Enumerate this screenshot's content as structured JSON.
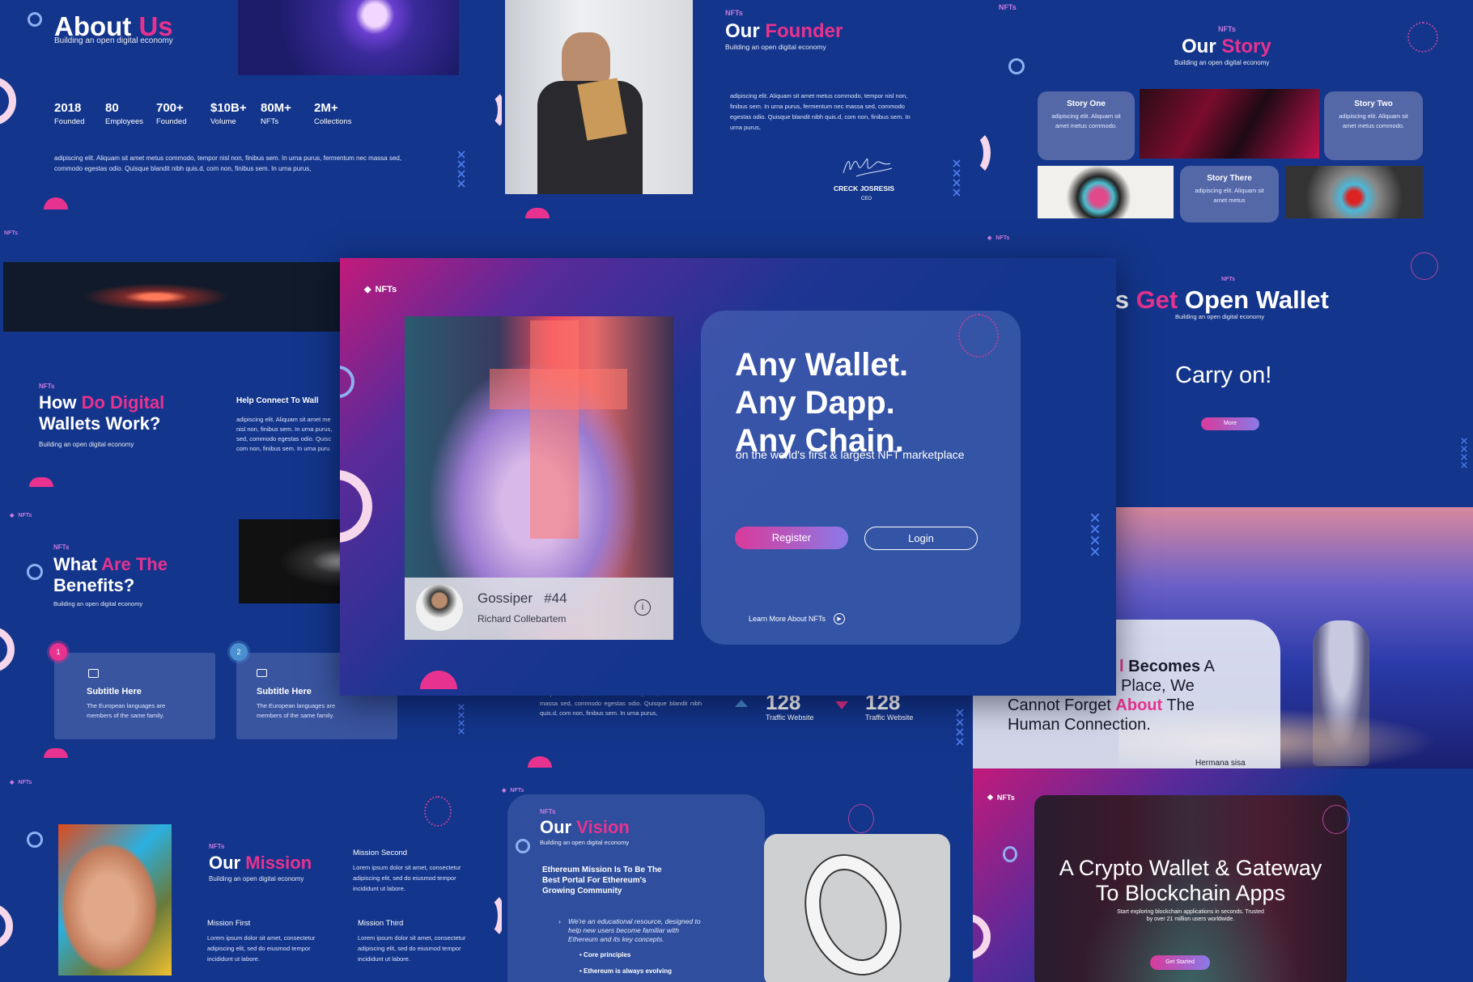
{
  "brand": "NFTs",
  "tagline": "Building an open digital economy",
  "colors": {
    "background": "#13358b",
    "accent": "#e8328f",
    "panel": "#3a55a0"
  },
  "about": {
    "title_a": "About",
    "title_b": "Us",
    "stats": [
      {
        "value": "2018",
        "label": "Founded"
      },
      {
        "value": "80",
        "label": "Employees"
      },
      {
        "value": "700+",
        "label": "Founded"
      },
      {
        "value": "$10B+",
        "label": "Volume"
      },
      {
        "value": "80M+",
        "label": "NFTs"
      },
      {
        "value": "2M+",
        "label": "Collections"
      }
    ],
    "body": "adipiscing elit. Aliquam sit amet metus commodo, tempor nisl non, finibus sem. In urna purus, fermentum nec massa sed, commodo egestas odio. Quisque blandit nibh quis.d, com non, finibus sem. In urna purus,"
  },
  "founder": {
    "title_a": "Our",
    "title_b": "Founder",
    "body": "adipiscing elit. Aliquam sit amet metus commodo, tempor nisl non, finibus sem. In urna purus, fermentum nec massa sed, commodo egestas odio. Quisque blandit nibh quis.d, com non, finibus sem. In urna purus,",
    "name": "CRECK JOSRESIS",
    "role": "CEO"
  },
  "story": {
    "title_a": "Our",
    "title_b": "Story",
    "cards": [
      {
        "title": "Story One",
        "text": "adipiscing elit. Aliquam sit amet metus commodo."
      },
      {
        "title": "Story Two",
        "text": "adipiscing elit. Aliquam sit amet metus commodo."
      },
      {
        "title": "Story There",
        "text": "adipiscing elit. Aliquam sit amet metus"
      }
    ]
  },
  "wallets": {
    "title_a": "How",
    "title_b": "Do Digital",
    "title_c": "Wallets Work?",
    "help_title": "Help Connect To Wall",
    "help_body": "adipiscing elit. Aliquam sit amet me nisl non, finibus sem. In urna purus, sed, commodo egestas odio. Quisc com non, finibus sem. In urna puru"
  },
  "benefits": {
    "title_a": "What",
    "title_b": "Are The",
    "title_c": "Benefits?",
    "cards": [
      {
        "num": "1",
        "title": "Subtitle Here",
        "text": "The European languages are members of the same family."
      },
      {
        "num": "2",
        "title": "Subtitle Here",
        "text": "The European languages are members of the same family."
      }
    ]
  },
  "hero": {
    "headline": [
      "Any Wallet.",
      "Any Dapp.",
      "Any Chain."
    ],
    "subline": "on the world's first & largest NFT marketplace",
    "register": "Register",
    "login": "Login",
    "learn_more": "Learn More About NFTs",
    "nft_name": "Gossiper",
    "nft_number": "#44",
    "creator": "Richard Collebartem"
  },
  "open_wallet": {
    "title_a": "t's",
    "title_b": "Get",
    "title_c": "Open Wallet",
    "carry": "Carry on!",
    "more": "More"
  },
  "traffic": {
    "body": "tempor nisl non, finibus sem. In urna purus, fermentum nec massa sed, commodo egestas odio. Quisque blandit nibh quis.d, com non, finibus sem. In urna purus,",
    "stats": [
      {
        "value": "128",
        "label": "Traffic Website",
        "direction": "up"
      },
      {
        "value": "128",
        "label": "Traffic Website",
        "direction": "down"
      }
    ]
  },
  "human": {
    "line1_a": "l",
    "line1_b": "Becomes",
    "line1_c": "A",
    "line2": "Place, We",
    "line3_a": "Cannot Forget",
    "line3_b": "About",
    "line3_c": "The",
    "line4": "Human Connection.",
    "author": "Hermana sisa"
  },
  "mission": {
    "title_a": "Our",
    "title_b": "Mission",
    "items": [
      {
        "title": "Mission Second",
        "text": "Lorem ipsum dolor sit amet, consectetur adipiscing elit, sed do eiusmod tempor incididunt ut labore."
      },
      {
        "title": "Mission First",
        "text": "Lorem ipsum dolor sit amet, consectetur adipiscing elit, sed do eiusmod tempor incididunt ut labore."
      },
      {
        "title": "Mission Third",
        "text": "Lorem ipsum dolor sit amet, consectetur adipiscing elit, sed do eiusmod tempor incididunt ut labore."
      }
    ]
  },
  "vision": {
    "title_a": "Our",
    "title_b": "Vision",
    "heading": "Ethereum Mission Is To Be The Best Portal For Ethereum's Growing Community",
    "quote": "We're an educational resource, designed to help new users become familiar with Ethereum and its key concepts.",
    "bullets": [
      "Core principles",
      "Ethereum is always evolving"
    ]
  },
  "crypto": {
    "title1": "A Crypto Wallet & Gateway",
    "title2": "To Blockchain Apps",
    "body": "Start exploring blockchain applications in seconds.  Trusted by over 21 million users worldwide.",
    "cta": "Get Started"
  }
}
